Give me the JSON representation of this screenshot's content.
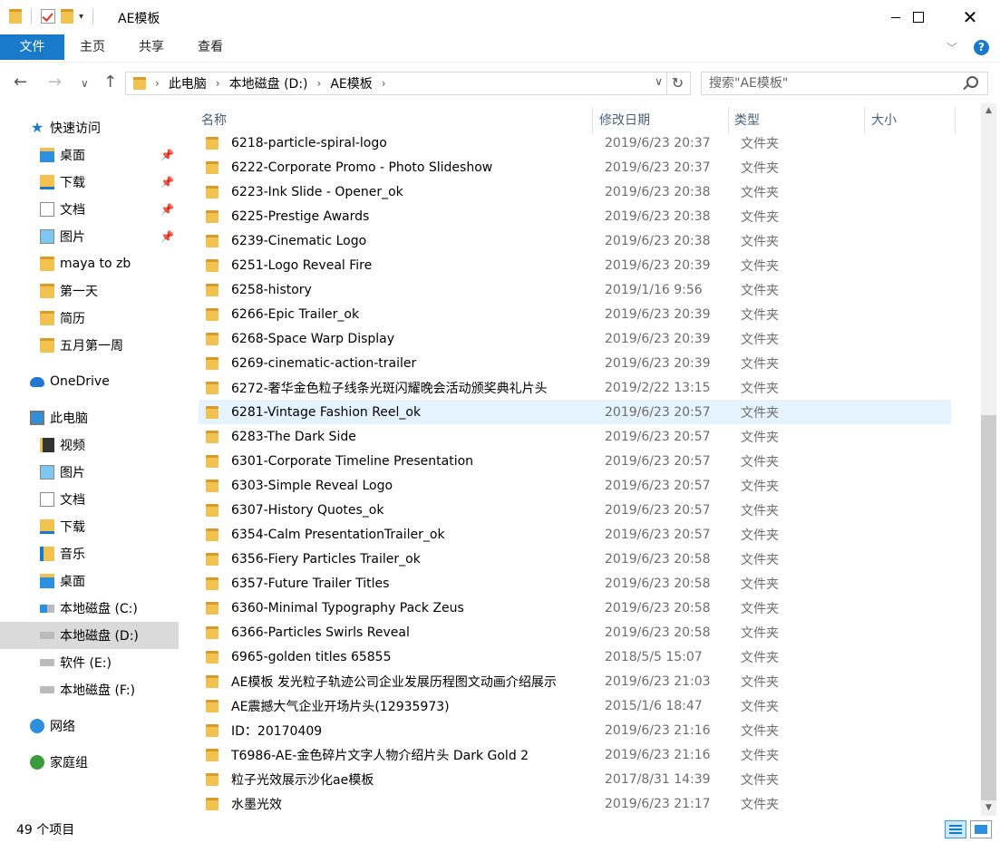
{
  "window": {
    "title": "AE模板"
  },
  "ribbon": {
    "file": "文件",
    "home": "主页",
    "share": "共享",
    "view": "查看",
    "help": "?"
  },
  "address": {
    "crumbs": [
      "此电脑",
      "本地磁盘 (D:)",
      "AE模板"
    ]
  },
  "search": {
    "placeholder": "搜索\"AE模板\""
  },
  "nav": {
    "items": [
      {
        "label": "快速访问",
        "icon": "star-icon"
      },
      {
        "label": "桌面",
        "icon": "desktop-folder-icon",
        "pinned": true
      },
      {
        "label": "下载",
        "icon": "download-folder-icon",
        "pinned": true
      },
      {
        "label": "文档",
        "icon": "documents-folder-icon",
        "pinned": true
      },
      {
        "label": "图片",
        "icon": "pictures-folder-icon",
        "pinned": true
      },
      {
        "label": "maya to zb",
        "icon": "folder-icon"
      },
      {
        "label": "第一天",
        "icon": "folder-icon"
      },
      {
        "label": "简历",
        "icon": "folder-icon"
      },
      {
        "label": "五月第一周",
        "icon": "folder-icon"
      },
      {
        "label": "OneDrive",
        "icon": "onedrive-icon"
      },
      {
        "label": "此电脑",
        "icon": "this-pc-icon"
      },
      {
        "label": "视频",
        "icon": "videos-folder-icon"
      },
      {
        "label": "图片",
        "icon": "pictures-folder-icon"
      },
      {
        "label": "文档",
        "icon": "documents-folder-icon"
      },
      {
        "label": "下载",
        "icon": "download-folder-icon"
      },
      {
        "label": "音乐",
        "icon": "music-folder-icon"
      },
      {
        "label": "桌面",
        "icon": "desktop-folder-icon"
      },
      {
        "label": "本地磁盘 (C:)",
        "icon": "windows-drive-icon"
      },
      {
        "label": "本地磁盘 (D:)",
        "icon": "drive-icon",
        "selected": true
      },
      {
        "label": "软件 (E:)",
        "icon": "drive-icon"
      },
      {
        "label": "本地磁盘 (F:)",
        "icon": "drive-icon"
      },
      {
        "label": "网络",
        "icon": "network-icon"
      },
      {
        "label": "家庭组",
        "icon": "homegroup-icon"
      }
    ]
  },
  "columns": {
    "name": "名称",
    "date": "修改日期",
    "type": "类型",
    "size": "大小"
  },
  "files": [
    {
      "name": "6218-particle-spiral-logo",
      "date": "2019/6/23 20:37",
      "type": "文件夹"
    },
    {
      "name": "6222-Corporate Promo - Photo Slideshow",
      "date": "2019/6/23 20:37",
      "type": "文件夹"
    },
    {
      "name": "6223-Ink Slide - Opener_ok",
      "date": "2019/6/23 20:38",
      "type": "文件夹"
    },
    {
      "name": "6225-Prestige Awards",
      "date": "2019/6/23 20:38",
      "type": "文件夹"
    },
    {
      "name": "6239-Cinematic Logo",
      "date": "2019/6/23 20:38",
      "type": "文件夹"
    },
    {
      "name": "6251-Logo Reveal Fire",
      "date": "2019/6/23 20:39",
      "type": "文件夹"
    },
    {
      "name": "6258-history",
      "date": "2019/1/16 9:56",
      "type": "文件夹"
    },
    {
      "name": "6266-Epic Trailer_ok",
      "date": "2019/6/23 20:39",
      "type": "文件夹"
    },
    {
      "name": "6268-Space Warp Display",
      "date": "2019/6/23 20:39",
      "type": "文件夹"
    },
    {
      "name": "6269-cinematic-action-trailer",
      "date": "2019/6/23 20:39",
      "type": "文件夹"
    },
    {
      "name": "6272-奢华金色粒子线条光斑闪耀晚会活动颁奖典礼片头",
      "date": "2019/2/22 13:15",
      "type": "文件夹"
    },
    {
      "name": "6281-Vintage Fashion Reel_ok",
      "date": "2019/6/23 20:57",
      "type": "文件夹",
      "hover": true
    },
    {
      "name": "6283-The Dark Side",
      "date": "2019/6/23 20:57",
      "type": "文件夹"
    },
    {
      "name": "6301-Corporate Timeline Presentation",
      "date": "2019/6/23 20:57",
      "type": "文件夹"
    },
    {
      "name": "6303-Simple Reveal Logo",
      "date": "2019/6/23 20:57",
      "type": "文件夹"
    },
    {
      "name": "6307-History Quotes_ok",
      "date": "2019/6/23 20:57",
      "type": "文件夹"
    },
    {
      "name": "6354-Calm PresentationTrailer_ok",
      "date": "2019/6/23 20:57",
      "type": "文件夹"
    },
    {
      "name": "6356-Fiery Particles Trailer_ok",
      "date": "2019/6/23 20:58",
      "type": "文件夹"
    },
    {
      "name": "6357-Future Trailer Titles",
      "date": "2019/6/23 20:58",
      "type": "文件夹"
    },
    {
      "name": "6360-Minimal Typography Pack  Zeus",
      "date": "2019/6/23 20:58",
      "type": "文件夹"
    },
    {
      "name": "6366-Particles Swirls Reveal",
      "date": "2019/6/23 20:58",
      "type": "文件夹"
    },
    {
      "name": "6965-golden titles 65855",
      "date": "2018/5/5 15:07",
      "type": "文件夹"
    },
    {
      "name": "AE模板 发光粒子轨迹公司企业发展历程图文动画介绍展示",
      "date": "2019/6/23 21:03",
      "type": "文件夹"
    },
    {
      "name": "AE震撼大气企业开场片头(12935973)",
      "date": "2015/1/6 18:47",
      "type": "文件夹"
    },
    {
      "name": "ID：20170409",
      "date": "2019/6/23 21:16",
      "type": "文件夹"
    },
    {
      "name": "T6986-AE-金色碎片文字人物介绍片头 Dark Gold 2",
      "date": "2019/6/23 21:16",
      "type": "文件夹"
    },
    {
      "name": "粒子光效展示沙化ae模板",
      "date": "2017/8/31 14:39",
      "type": "文件夹"
    },
    {
      "name": "水墨光效",
      "date": "2019/6/23 21:17",
      "type": "文件夹"
    }
  ],
  "status": {
    "count": "49 个项目"
  },
  "colors": {
    "accent": "#1979ca",
    "folder": "#f1c24f",
    "hover": "#e5f3ff",
    "selected_nav": "#dadada"
  }
}
